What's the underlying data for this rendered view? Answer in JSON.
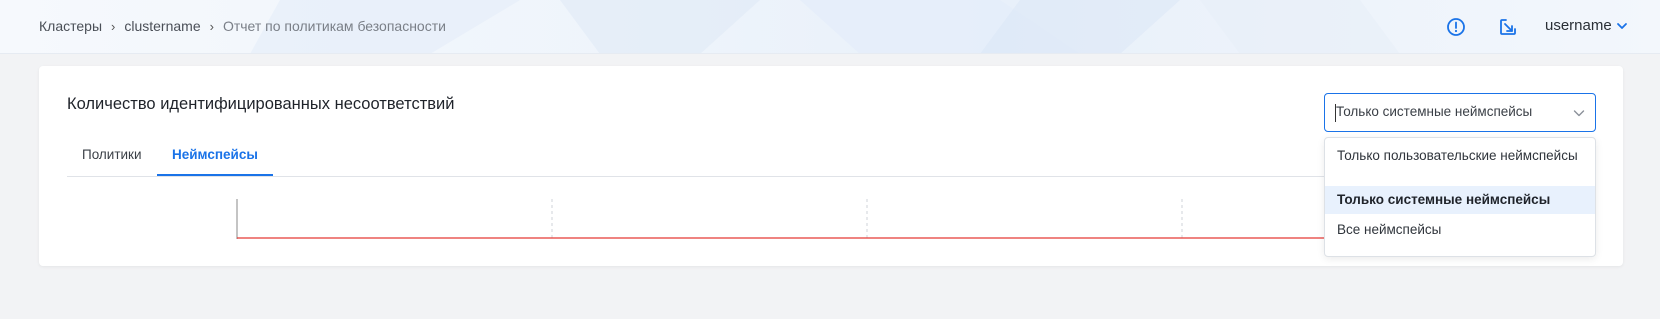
{
  "breadcrumb": {
    "items": [
      {
        "label": "Кластеры"
      },
      {
        "label": "clustername"
      },
      {
        "label": "Отчет по политикам безопасности"
      }
    ],
    "separator": "›"
  },
  "header": {
    "icons": [
      "alert-circle-icon",
      "external-link-icon"
    ],
    "username": "username",
    "accent": "#1a73e8"
  },
  "card": {
    "title": "Количество идентифицированных несоответствий"
  },
  "tabs": [
    {
      "label": "Политики",
      "active": false
    },
    {
      "label": "Неймспейсы",
      "active": true
    }
  ],
  "namespace_filter": {
    "selected": "Только системные неймспейсы",
    "options": [
      {
        "label": "Только пользовательские неймспейсы",
        "selected": false
      },
      {
        "label": "Только системные неймспейсы",
        "selected": true
      },
      {
        "label": "Все неймспейсы",
        "selected": false
      }
    ]
  },
  "chart": {
    "line_color": "#e53935",
    "grid": "dashed"
  }
}
